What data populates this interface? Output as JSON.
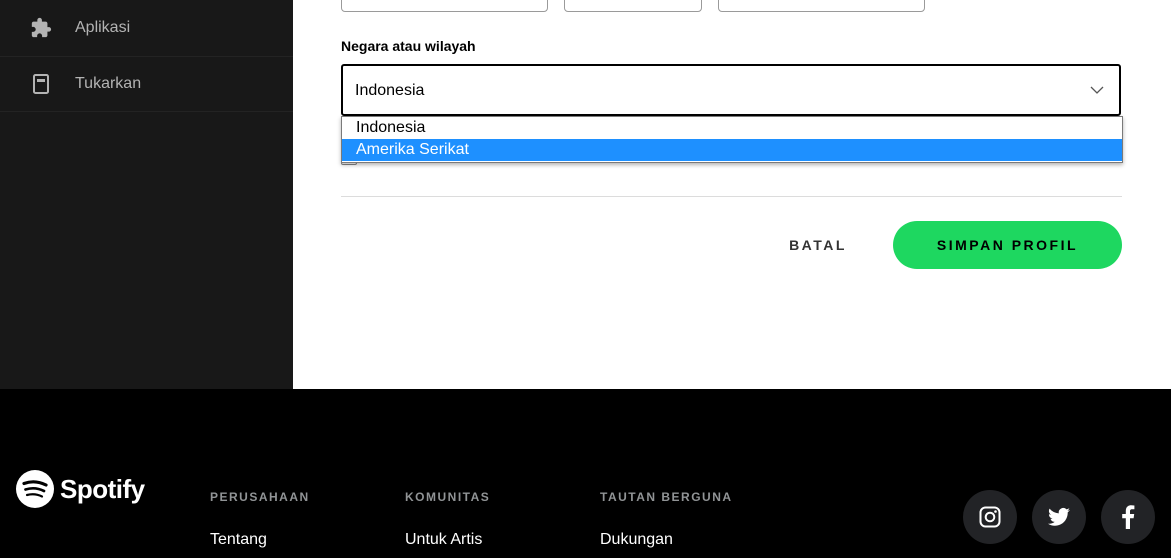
{
  "sidebar": {
    "items": [
      {
        "label": "Aplikasi",
        "icon": "puzzle-icon"
      },
      {
        "label": "Tukarkan",
        "icon": "redeem-card-icon"
      }
    ]
  },
  "form": {
    "country_label": "Negara atau wilayah",
    "country_selected": "Indonesia",
    "country_options": [
      "Indonesia",
      "Amerika Serikat"
    ],
    "highlighted_option": "Amerika Serikat",
    "cancel_label": "BATAL",
    "save_label": "SIMPAN PROFIL"
  },
  "footer": {
    "brand": "Spotify",
    "columns": [
      {
        "heading": "PERUSAHAAN",
        "link": "Tentang"
      },
      {
        "heading": "KOMUNITAS",
        "link": "Untuk Artis"
      },
      {
        "heading": "TAUTAN BERGUNA",
        "link": "Dukungan"
      }
    ],
    "social": [
      "instagram-icon",
      "twitter-icon",
      "facebook-icon"
    ]
  },
  "colors": {
    "accent": "#1ed760",
    "highlight": "#1e90ff",
    "sidebar_bg": "#181818",
    "footer_bg": "#000000"
  }
}
